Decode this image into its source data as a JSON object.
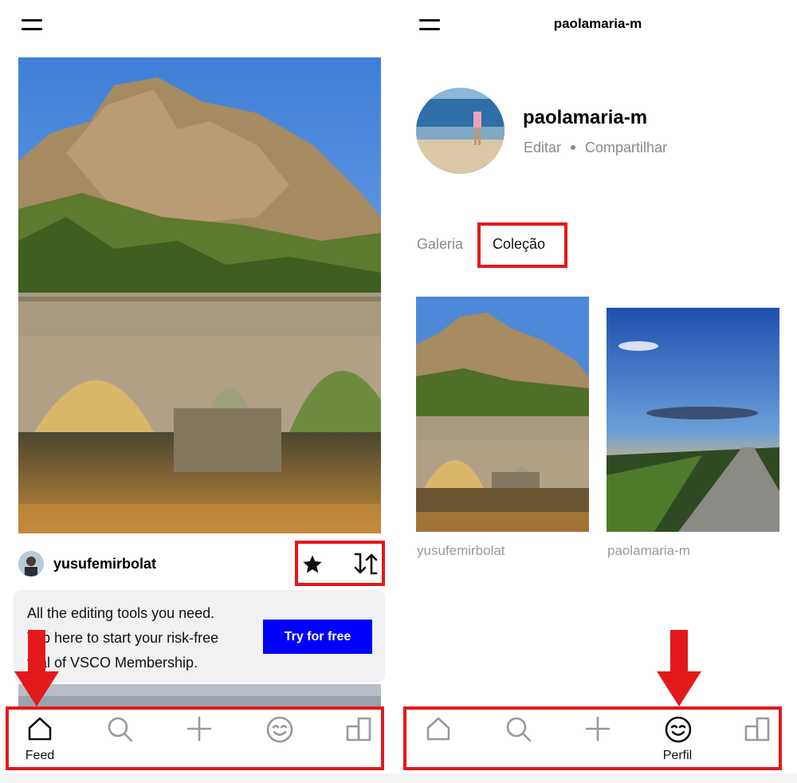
{
  "left_screen": {
    "post": {
      "username": "yusufemirbolat"
    },
    "promo": {
      "line1": "All the editing tools you need.",
      "line2": "Tap here to start your risk-free",
      "line3": "trial of VSCO Membership.",
      "button_label": "Try for free"
    },
    "nav": {
      "items": [
        {
          "icon": "home-icon",
          "label": "Feed",
          "active": true
        },
        {
          "icon": "search-icon",
          "label": ""
        },
        {
          "icon": "plus-icon",
          "label": ""
        },
        {
          "icon": "smiley-face-icon",
          "label": ""
        },
        {
          "icon": "studio-icon",
          "label": ""
        }
      ]
    }
  },
  "right_screen": {
    "header_title": "paolamaria-m",
    "profile": {
      "name": "paolamaria-m",
      "edit_label": "Editar",
      "share_label": "Compartilhar"
    },
    "tabs": [
      {
        "label": "Galeria",
        "active": false
      },
      {
        "label": "Coleção",
        "active": true
      }
    ],
    "collection": [
      {
        "caption": "yusufemirbolat"
      },
      {
        "caption": "paolamaria-m"
      }
    ],
    "nav": {
      "items": [
        {
          "icon": "home-icon",
          "label": ""
        },
        {
          "icon": "search-icon",
          "label": ""
        },
        {
          "icon": "plus-icon",
          "label": ""
        },
        {
          "icon": "smiley-face-icon",
          "label": "Perfil",
          "active": true
        },
        {
          "icon": "studio-icon",
          "label": ""
        }
      ]
    }
  },
  "colors": {
    "highlight_red": "#e3191c",
    "button_blue": "#0000ff",
    "promo_bg": "#f1f1f3",
    "muted_text": "#8a8a8a"
  }
}
